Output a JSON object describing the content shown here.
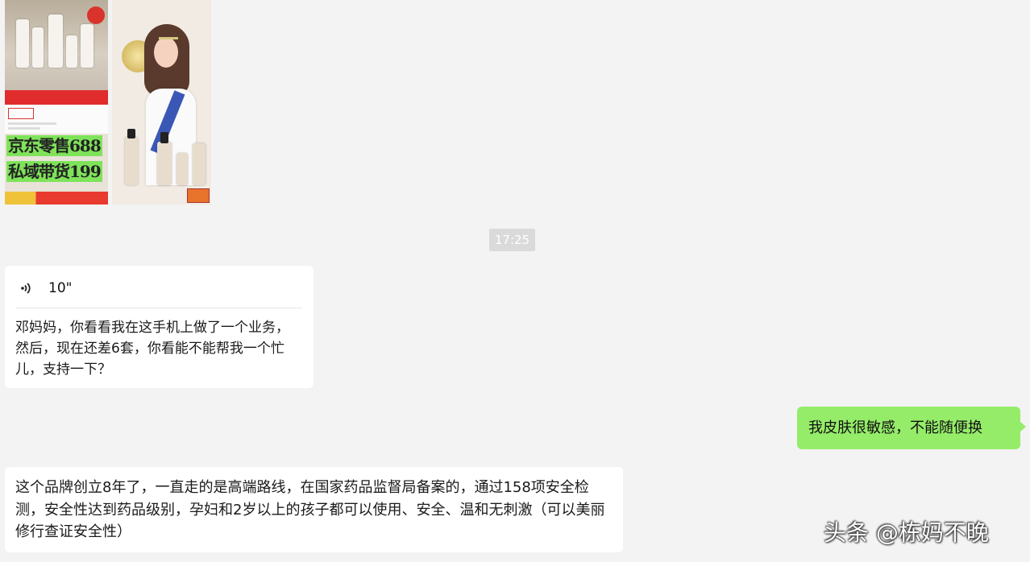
{
  "image_message": {
    "left_overlay_line1": "京东零售688",
    "left_overlay_line2": "私域带货199"
  },
  "timestamp": "17:25",
  "voice_message": {
    "duration": "10\"",
    "transcript": "邓妈妈，你看看我在这手机上做了一个业务，然后，现在还差6套，你看能不能帮我一个忙儿，支持一下？",
    "icon": "voice-wave-icon"
  },
  "outgoing_message": {
    "text": "我皮肤很敏感，不能随便换"
  },
  "incoming_message": {
    "text": "这个品牌创立8年了，一直走的是高端路线，在国家药品监督局备案的，通过158项安全检测，安全性达到药品级别，孕妇和2岁以上的孩子都可以使用、安全、温和无刺激（可以美丽修行查证安全性）"
  },
  "watermark": "头条 @栋妈不晚",
  "colors": {
    "background": "#f3f3f3",
    "outgoing_bubble": "#95ec69",
    "incoming_bubble": "#ffffff",
    "timestamp_bg": "#dadada"
  }
}
